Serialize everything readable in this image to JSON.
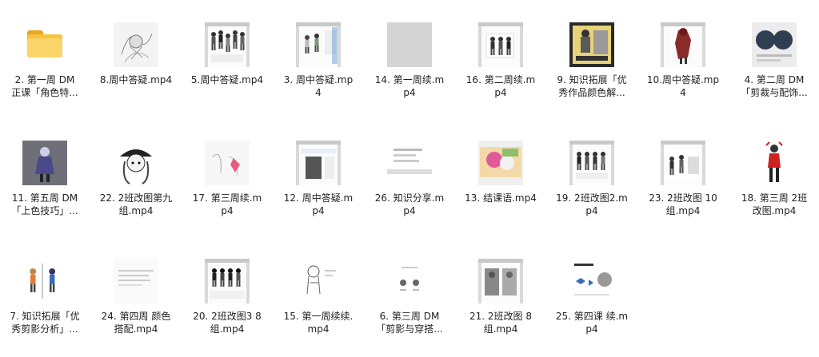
{
  "folder": {
    "icon": "folder-icon",
    "color": "#f6c343",
    "line1": "2. 第一周 DM",
    "line2": "正课「角色特..."
  },
  "items": [
    {
      "thumb": "thumb-sketch-gray",
      "line1": "8.周中答疑.mp4",
      "line2": ""
    },
    {
      "thumb": "thumb-character-sheet",
      "line1": "5.周中答疑.mp4",
      "line2": ""
    },
    {
      "thumb": "thumb-figures-white",
      "line1": "3. 周中答疑.mp",
      "line2": "4"
    },
    {
      "thumb": "thumb-blank-gray",
      "line1": "14. 第一周续.m",
      "line2": "p4"
    },
    {
      "thumb": "thumb-app-window",
      "line1": "16. 第二周续.m",
      "line2": "p4"
    },
    {
      "thumb": "thumb-poster-yellow",
      "line1": "9. 知识拓展「优",
      "line2": "秀作品颜色解..."
    },
    {
      "thumb": "thumb-red-character",
      "line1": "10.周中答疑.mp",
      "line2": "4"
    },
    {
      "thumb": "thumb-circles-dark",
      "line1": "4. 第二周 DM",
      "line2": "「剪裁与配饰..."
    },
    {
      "thumb": "thumb-purple-figure",
      "line1": "11. 第五周 DM",
      "line2": "「上色技巧」..."
    },
    {
      "thumb": "thumb-girl-hat",
      "line1": "22. 2班改图第九",
      "line2": "组.mp4"
    },
    {
      "thumb": "thumb-sketch-pink",
      "line1": "17. 第三周续.m",
      "line2": "p4"
    },
    {
      "thumb": "thumb-ui-window",
      "line1": "12. 周中答疑.m",
      "line2": "p4"
    },
    {
      "thumb": "thumb-text-slide",
      "line1": "26. 知识分享.m",
      "line2": "p4"
    },
    {
      "thumb": "thumb-colorful-photo",
      "line1": "13. 结课语.mp4",
      "line2": ""
    },
    {
      "thumb": "thumb-figures-row",
      "line1": "19. 2班改图2.m",
      "line2": "p4"
    },
    {
      "thumb": "thumb-app-figures",
      "line1": "23. 2班改图 10",
      "line2": "组.mp4"
    },
    {
      "thumb": "thumb-red-figure",
      "line1": "18. 第三周 2班",
      "line2": "改图.mp4"
    },
    {
      "thumb": "thumb-color-figures",
      "line1": "7. 知识拓展「优",
      "line2": "秀剪影分析」..."
    },
    {
      "thumb": "thumb-text-lines",
      "line1": "24. 第四周 颜色",
      "line2": "搭配.mp4"
    },
    {
      "thumb": "thumb-dark-figures",
      "line1": "20. 2班改图3 8",
      "line2": "组.mp4"
    },
    {
      "thumb": "thumb-figure-lineart",
      "line1": "15. 第一周续续.",
      "line2": "mp4"
    },
    {
      "thumb": "thumb-icons-slide",
      "line1": "6. 第三周 DM",
      "line2": "「剪影与穿搭..."
    },
    {
      "thumb": "thumb-app-gray",
      "line1": "21. 2班改图 8",
      "line2": "组.mp4"
    },
    {
      "thumb": "thumb-diagram-slide",
      "line1": "25. 第四课 续.m",
      "line2": "p4"
    }
  ]
}
